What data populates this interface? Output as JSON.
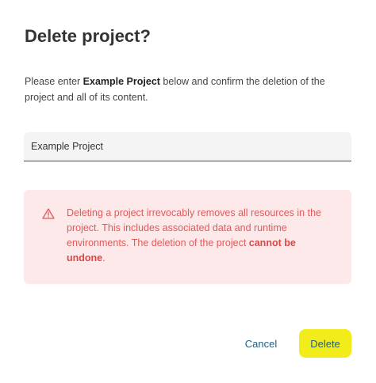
{
  "dialog": {
    "title": "Delete project?",
    "description": {
      "prefix": "Please enter ",
      "project_name": "Example Project",
      "suffix": " below and confirm the deletion of the project and all of its content."
    },
    "confirm_input": {
      "value": "Example Project",
      "placeholder": ""
    },
    "warning": {
      "icon": "warning-triangle-icon",
      "text_main": "Deleting a project irrevocably removes all resources in the project. This includes associated data and runtime environments. The deletion of the project ",
      "text_emphasis": "cannot be undone",
      "text_end": "."
    },
    "actions": {
      "cancel_label": "Cancel",
      "delete_label": "Delete"
    }
  },
  "colors": {
    "accent_yellow": "#f2ec1a",
    "link_blue": "#1d5f86",
    "warning_bg": "#fde9e9",
    "warning_text": "#e05a5a"
  }
}
